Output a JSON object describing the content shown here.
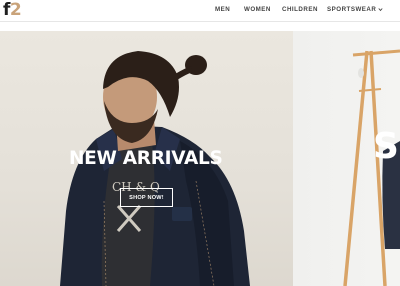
{
  "brand": {
    "logo_letter": "f",
    "logo_number": "2"
  },
  "nav": {
    "items": [
      {
        "label": "MEN"
      },
      {
        "label": "WOMEN"
      },
      {
        "label": "CHILDREN"
      },
      {
        "label": "SPORTSWEAR"
      }
    ]
  },
  "hero": {
    "title": "NEW ARRIVALS",
    "button_label": "SHOP NOW!",
    "next_slide_title_fragment": "S",
    "shirt_text": "CH & Q"
  },
  "colors": {
    "logo_accent": "#c9a37a",
    "nav_text": "#444444",
    "hero_text": "#ffffff",
    "jacket": "#1e2535"
  },
  "icons": {
    "sportswear_dropdown": "chevron-down-icon"
  }
}
